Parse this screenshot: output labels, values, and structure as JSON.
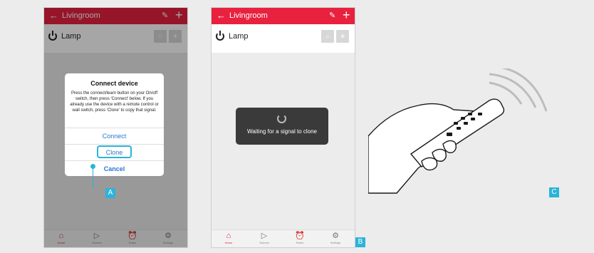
{
  "app": {
    "header_title": "Livingroom",
    "device_name": "Lamp",
    "off_symbol": "○",
    "on_symbol": "☀"
  },
  "tabs": [
    {
      "label": "Home",
      "icon": "home-icon"
    },
    {
      "label": "Scenes",
      "icon": "play-icon"
    },
    {
      "label": "Rules",
      "icon": "alarm-icon"
    },
    {
      "label": "Settings",
      "icon": "gear-icon"
    }
  ],
  "dialog": {
    "title": "Connect device",
    "body": "Press the connect/learn button on your On/off switch, then press 'Connect' below. If you already use the device with a remote control or wall switch, press 'Clone' to copy that signal.",
    "connect": "Connect",
    "clone": "Clone",
    "cancel": "Cancel"
  },
  "toast": {
    "message": "Waiting for a signal to clone"
  },
  "markers": {
    "a": "A",
    "b": "B",
    "c": "C"
  },
  "colors": {
    "accent": "#e8213f",
    "callout": "#2bb4d8",
    "link": "#2a76d2"
  }
}
